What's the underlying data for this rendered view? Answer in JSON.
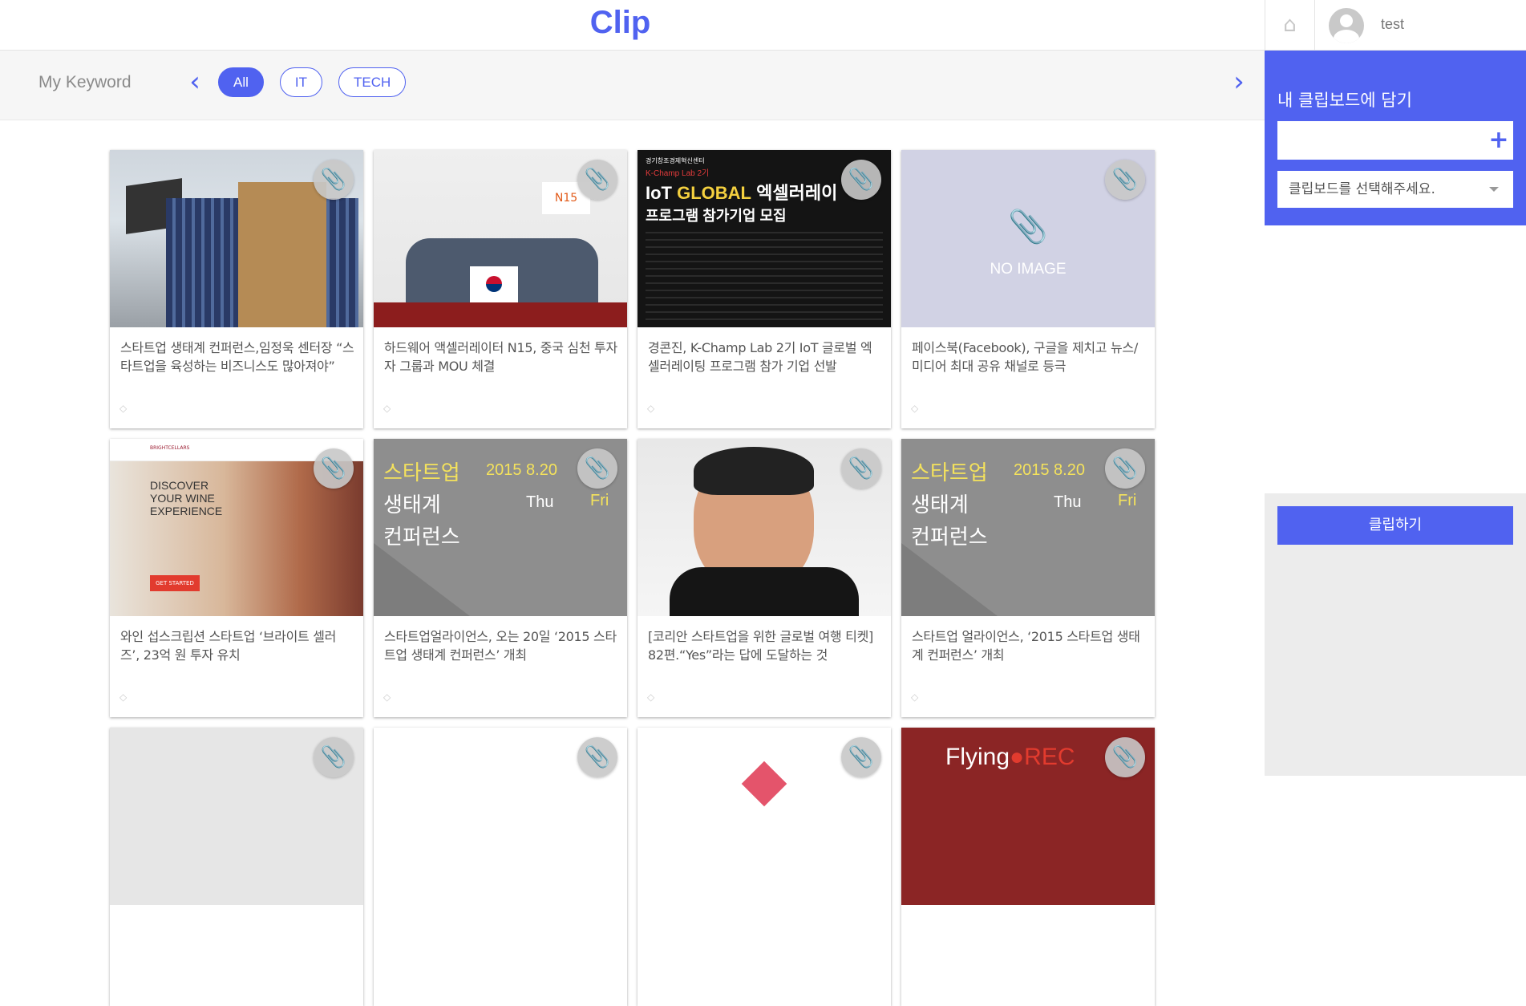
{
  "header": {
    "logo": "Clip"
  },
  "keywords": {
    "title": "My Keyword",
    "prev_icon": "chevron-left-icon",
    "next_icon": "chevron-right-icon",
    "chips": [
      {
        "label": "All",
        "active": true
      },
      {
        "label": "IT",
        "active": false
      },
      {
        "label": "TECH",
        "active": false
      }
    ]
  },
  "cards": [
    {
      "title": "스타트업 생태계 컨퍼런스,임정욱 센터장 “스타트업을 육성하는 비즈니스도 많아져야”"
    },
    {
      "title": "하드웨어 액셀러레이터 N15, 중국 심천 투자자 그룹과 MOU 체결"
    },
    {
      "title": "경콘진, K-Champ Lab 2기 IoT 글로벌 엑셀러레이팅 프로그램 참가 기업 선발"
    },
    {
      "title": "페이스북(Facebook), 구글을 제치고 뉴스/미디어 최대 공유 채널로 등극"
    },
    {
      "title": "와인 섭스크립션 스타트업 ‘브라이트 셀러즈’, 23억 원 투자 유치"
    },
    {
      "title": "스타트업얼라이언스, 오는 20일 ‘2015 스타트업 생태계 컨퍼런스’ 개최"
    },
    {
      "title": "[코리안 스타트업을 위한 글로벌 여행 티켓] 82편.“Yes”라는 답에 도달하는 것"
    },
    {
      "title": "스타트업 얼라이언스, ‘2015 스타트업 생태계 컨퍼런스’ 개최"
    }
  ],
  "thumbs": {
    "t2_banner": "N15",
    "t3_org": "경기창조경제혁신센터",
    "t3_sub": "K-Champ Lab 2기",
    "t3_head_a": "IoT ",
    "t3_head_b": "GLOBAL",
    "t3_head_c": " 엑셀러레이",
    "t3_head2": "프로그램 참가기업 모집",
    "no_image": "NO IMAGE",
    "t5_brand": "BRIGHTCELLARS",
    "t5_copy": "DISCOVER YOUR WINE EXPERIENCE",
    "t5_cta": "GET STARTED",
    "t6_l1": "스타트업",
    "t6_l2": "생태계",
    "t6_l3": "컨퍼런스",
    "t6_date": "2015   8.20",
    "t6_thu": "Thu",
    "t6_fri": "Fri",
    "t12_a": "Flying",
    "t12_b": "REC"
  },
  "user": {
    "name": "test",
    "home_icon": "home-icon",
    "avatar_icon": "user-avatar-icon"
  },
  "clipboard": {
    "title": "내 클립보드에 담기",
    "input_value": "",
    "add_icon": "plus-icon",
    "select_value": "클립보드를 선택해주세요.",
    "submit_label": "클립하기"
  },
  "colors": {
    "accent": "#5062f0",
    "panel_bg": "#ececec"
  }
}
